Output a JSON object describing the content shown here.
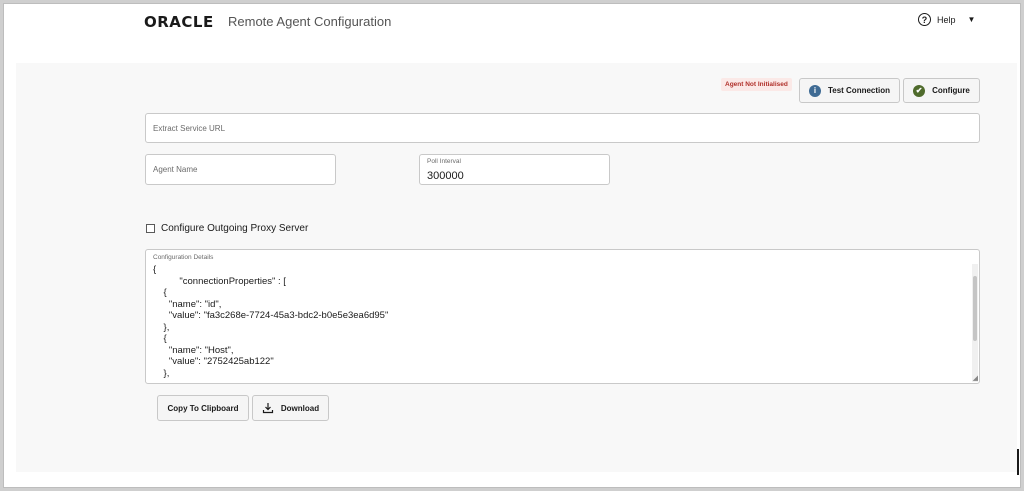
{
  "header": {
    "brand": "ORACLE",
    "title": "Remote Agent Configuration",
    "help_label": "Help",
    "help_icon": "?",
    "caret": "▼"
  },
  "toolbar": {
    "status": "Agent Not Initialised",
    "test_connection_label": "Test Connection",
    "test_connection_icon": "i",
    "configure_label": "Configure",
    "configure_icon": "✔"
  },
  "form": {
    "extract_url_placeholder": "Extract Service URL",
    "agent_name_placeholder": "Agent Name",
    "poll_interval_label": "Poll Interval",
    "poll_interval_value": "300000",
    "proxy_label": "Configure Outgoing Proxy Server",
    "proxy_checked": false
  },
  "config": {
    "label": "Configuration Details",
    "text": "{\n          \"connectionProperties\" : [\n    {\n      \"name\": \"id\",\n      \"value\": \"fa3c268e-7724-45a3-bdc2-b0e5e3ea6d95\"\n    },\n    {\n      \"name\": \"Host\",\n      \"value\": \"2752425ab122\"\n    },",
    "resize_glyph": "◢"
  },
  "actions": {
    "copy_label": "Copy To Clipboard",
    "download_label": "Download"
  },
  "colors": {
    "info_icon": "#3f6b94",
    "configure_icon": "#4f6b2c",
    "status_text": "#b0302a",
    "status_bg": "#fbe9e7"
  }
}
